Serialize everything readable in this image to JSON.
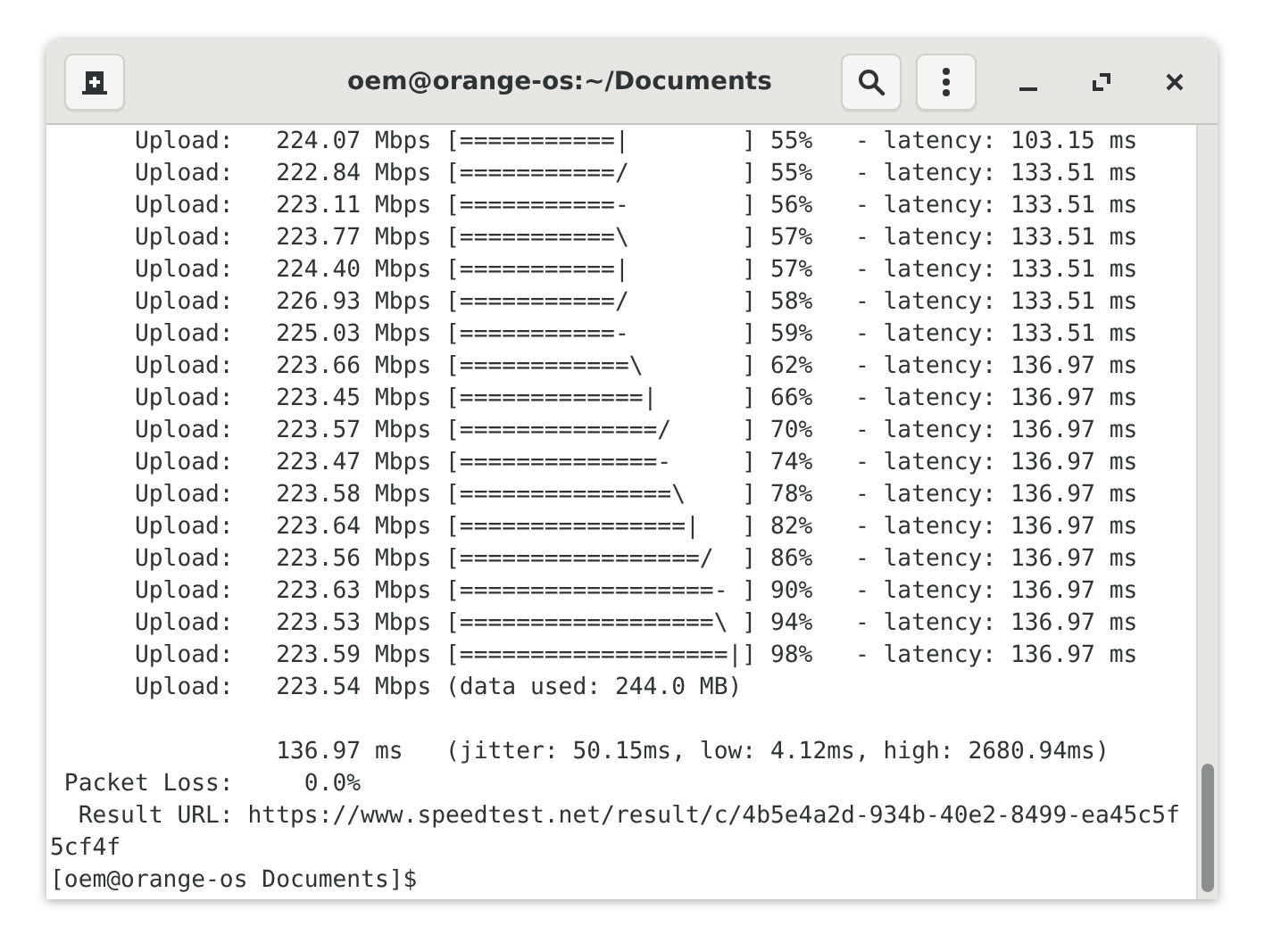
{
  "window": {
    "title": "oem@orange-os:~/Documents"
  },
  "output_blocks": [
    [
      "      Upload:   224.07 Mbps [===========|        ] 55%   - latency: 103.15 ms",
      "      Upload:   222.84 Mbps [===========/        ] 55%   - latency: 133.51 ms",
      "      Upload:   223.11 Mbps [===========-        ] 56%   - latency: 133.51 ms",
      "      Upload:   223.77 Mbps [===========\\        ] 57%   - latency: 133.51 ms",
      "      Upload:   224.40 Mbps [===========|        ] 57%   - latency: 133.51 ms",
      "      Upload:   226.93 Mbps [===========/        ] 58%   - latency: 133.51 ms",
      "      Upload:   225.03 Mbps [===========-        ] 59%   - latency: 133.51 ms",
      "      Upload:   223.66 Mbps [============\\       ] 62%   - latency: 136.97 ms",
      "      Upload:   223.45 Mbps [=============|      ] 66%   - latency: 136.97 ms",
      "      Upload:   223.57 Mbps [==============/     ] 70%   - latency: 136.97 ms",
      "      Upload:   223.47 Mbps [==============-     ] 74%   - latency: 136.97 ms",
      "      Upload:   223.58 Mbps [===============\\    ] 78%   - latency: 136.97 ms",
      "      Upload:   223.64 Mbps [================|   ] 82%   - latency: 136.97 ms",
      "      Upload:   223.56 Mbps [=================/  ] 86%   - latency: 136.97 ms",
      "      Upload:   223.63 Mbps [==================- ] 90%   - latency: 136.97 ms",
      "      Upload:   223.53 Mbps [==================\\ ] 94%   - latency: 136.97 ms",
      "      Upload:   223.59 Mbps [===================|] 98%   - latency: 136.97 ms",
      "      Upload:   223.54 Mbps (data used: 244.0 MB)"
    ],
    [
      "                136.97 ms   (jitter: 50.15ms, low: 4.12ms, high: 2680.94ms)",
      " Packet Loss:     0.0%",
      "  Result URL: https://www.speedtest.net/result/c/4b5e4a2d-934b-40e2-8499-ea45c5f",
      "5cf4f",
      "[oem@orange-os Documents]$"
    ]
  ]
}
